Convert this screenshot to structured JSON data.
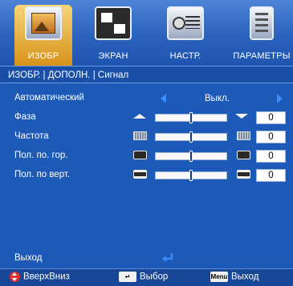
{
  "tabs": [
    {
      "label": "ИЗОБР",
      "icon": "image-icon",
      "active": true
    },
    {
      "label": "ЭКРАН",
      "icon": "screen-icon",
      "active": false
    },
    {
      "label": "НАСТР.",
      "icon": "projector-settings-icon",
      "active": false
    },
    {
      "label": "ПАРАМЕТРЫ",
      "icon": "options-icon",
      "active": false
    }
  ],
  "breadcrumb": "ИЗОБР. | ДОПОЛН. | Сигнал",
  "menu": {
    "automatic": {
      "label": "Автоматический",
      "value": "Выкл."
    },
    "phase": {
      "label": "Фаза",
      "value": "0",
      "level": 0.5
    },
    "frequency": {
      "label": "Частота",
      "value": "0",
      "level": 0.5
    },
    "h_position": {
      "label": "Пол. по. гор.",
      "value": "0",
      "level": 0.5
    },
    "v_position": {
      "label": "Пол. по верт.",
      "value": "0",
      "level": 0.5
    },
    "exit": {
      "label": "Выход"
    }
  },
  "help": {
    "updown_label": "ВверхВниз",
    "select_label": "Выбор",
    "menu_key": "Menu",
    "exit_label": "Выход"
  },
  "colors": {
    "background": "#1d5ab7",
    "active_tab": "#e8a93a",
    "arrow": "#3a8dff",
    "updown_icon": "#e33030"
  }
}
